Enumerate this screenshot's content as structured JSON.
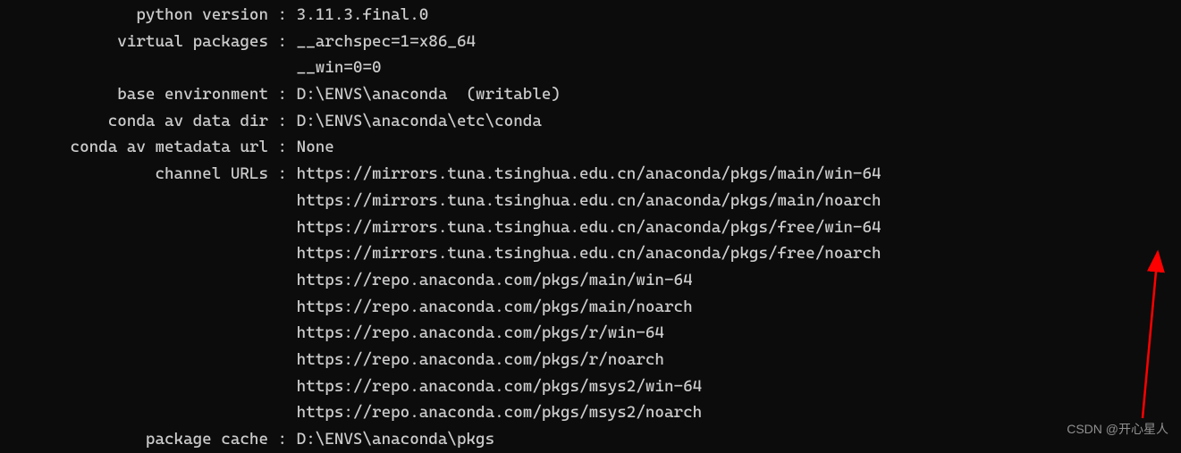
{
  "lines": [
    {
      "label": "python version",
      "value": "3.11.3.final.0"
    },
    {
      "label": "virtual packages",
      "value": "__archspec=1=x86_64"
    },
    {
      "label": "",
      "value": "__win=0=0",
      "nosep": true
    },
    {
      "label": "base environment",
      "value": "D:\\ENVS\\anaconda  (writable)"
    },
    {
      "label": "conda av data dir",
      "value": "D:\\ENVS\\anaconda\\etc\\conda"
    },
    {
      "label": "conda av metadata url",
      "value": "None"
    },
    {
      "label": "channel URLs",
      "value": "https://mirrors.tuna.tsinghua.edu.cn/anaconda/pkgs/main/win-64"
    },
    {
      "label": "",
      "value": "https://mirrors.tuna.tsinghua.edu.cn/anaconda/pkgs/main/noarch",
      "nosep": true
    },
    {
      "label": "",
      "value": "https://mirrors.tuna.tsinghua.edu.cn/anaconda/pkgs/free/win-64",
      "nosep": true
    },
    {
      "label": "",
      "value": "https://mirrors.tuna.tsinghua.edu.cn/anaconda/pkgs/free/noarch",
      "nosep": true
    },
    {
      "label": "",
      "value": "https://repo.anaconda.com/pkgs/main/win-64",
      "nosep": true
    },
    {
      "label": "",
      "value": "https://repo.anaconda.com/pkgs/main/noarch",
      "nosep": true
    },
    {
      "label": "",
      "value": "https://repo.anaconda.com/pkgs/r/win-64",
      "nosep": true
    },
    {
      "label": "",
      "value": "https://repo.anaconda.com/pkgs/r/noarch",
      "nosep": true
    },
    {
      "label": "",
      "value": "https://repo.anaconda.com/pkgs/msys2/win-64",
      "nosep": true
    },
    {
      "label": "",
      "value": "https://repo.anaconda.com/pkgs/msys2/noarch",
      "nosep": true
    },
    {
      "label": "package cache",
      "value": "D:\\ENVS\\anaconda\\pkgs"
    }
  ],
  "separator": " : ",
  "blank_sep": "   ",
  "watermark": "CSDN @开心星人"
}
